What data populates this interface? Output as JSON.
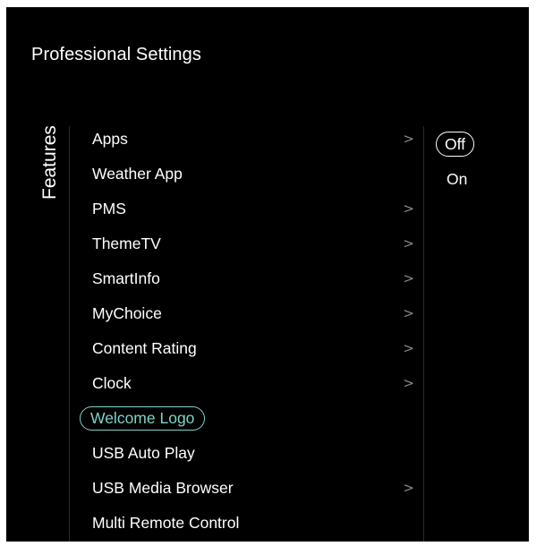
{
  "page": {
    "title": "Professional Settings",
    "section": "Features"
  },
  "menu": {
    "items": [
      {
        "label": "Apps",
        "has_submenu": true
      },
      {
        "label": "Weather App",
        "has_submenu": false
      },
      {
        "label": "PMS",
        "has_submenu": true
      },
      {
        "label": "ThemeTV",
        "has_submenu": true
      },
      {
        "label": "SmartInfo",
        "has_submenu": true
      },
      {
        "label": "MyChoice",
        "has_submenu": true
      },
      {
        "label": "Content Rating",
        "has_submenu": true
      },
      {
        "label": "Clock",
        "has_submenu": true
      },
      {
        "label": "Welcome Logo",
        "has_submenu": false,
        "selected": true
      },
      {
        "label": "USB Auto Play",
        "has_submenu": false
      },
      {
        "label": "USB Media Browser",
        "has_submenu": true
      },
      {
        "label": "Multi Remote Control",
        "has_submenu": false
      }
    ],
    "chevron_glyph": ">"
  },
  "options": {
    "items": [
      {
        "label": "Off",
        "selected": true
      },
      {
        "label": "On",
        "selected": false
      }
    ]
  },
  "colors": {
    "background": "#000000",
    "text": "#ffffff",
    "accent": "#7ed3cb",
    "chevron": "#8a8a8a"
  }
}
